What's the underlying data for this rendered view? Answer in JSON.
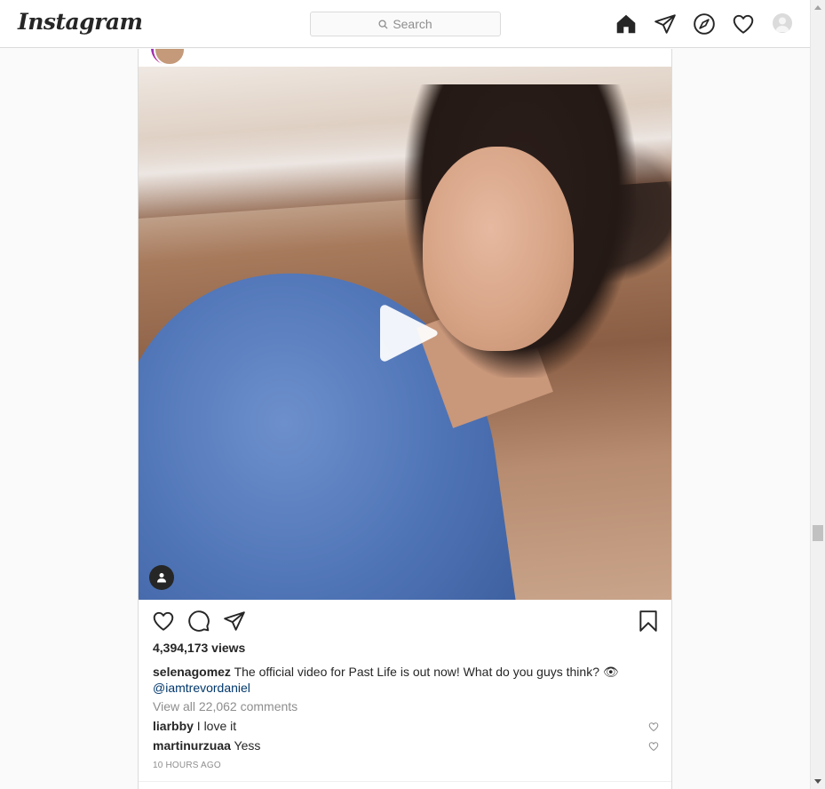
{
  "header": {
    "logo_text": "Instagram",
    "search_placeholder": "Search",
    "nav_icons": [
      "home-icon",
      "direct-icon",
      "explore-icon",
      "activity-icon",
      "profile-avatar"
    ]
  },
  "post": {
    "media_overlay": {
      "play_icon": "play-icon",
      "tag_icon": "user-tag-icon"
    },
    "actions": {
      "icons": [
        "heart-icon",
        "comment-icon",
        "share-icon",
        "bookmark-icon"
      ]
    },
    "views": "4,394,173 views",
    "caption": {
      "username": "selenagomez",
      "text": " The official video for Past Life is out now! What do you guys think? 👁",
      "mention": "@iamtrevordaniel"
    },
    "view_all_comments": "View all 22,062 comments",
    "comments": [
      {
        "username": "liarbby",
        "text": " I love it"
      },
      {
        "username": "martinurzuaa",
        "text": " Yess"
      }
    ],
    "timestamp": "10 HOURS AGO"
  },
  "colors": {
    "text_primary": "#262626",
    "text_secondary": "#8e8e8e",
    "link": "#00376b",
    "border": "#dbdbdb"
  }
}
